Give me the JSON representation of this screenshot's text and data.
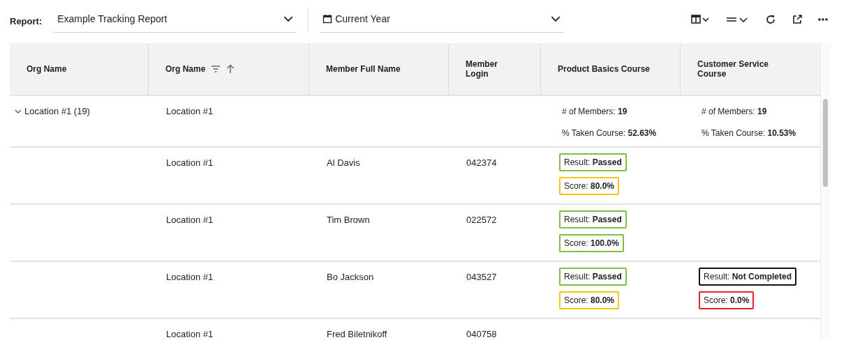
{
  "toolbar": {
    "report_label": "Report:",
    "report_select": "Example Tracking Report",
    "period_select": "Current Year"
  },
  "table": {
    "columns": [
      {
        "label": "Org Name"
      },
      {
        "label": "Org Name",
        "filterable": true,
        "sorted_ascending": true
      },
      {
        "label": "Member Full Name"
      },
      {
        "label": "Member Login"
      },
      {
        "label": "Product Basics Course"
      },
      {
        "label": "Customer Service Course"
      }
    ],
    "rows": [
      {
        "kind": "group",
        "expanded": true,
        "group": "Location #1 (19)",
        "org": "Location #1",
        "courses": {
          "product_basics": {
            "lines": [
              "# of Members: **19**",
              "% Taken Course: **52.63%**"
            ]
          },
          "customer_service": {
            "lines": [
              "# of Members: **19**",
              "% Taken Course: **10.53%**"
            ]
          }
        }
      },
      {
        "kind": "member",
        "org": "Location #1",
        "name": "Al Davis",
        "login": "042374",
        "courses": {
          "product_basics": {
            "tags": [
              {
                "text": "Result: **Passed**",
                "color": "#7ac143"
              },
              {
                "text": "Score: **80.0%**",
                "color": "#f5c518"
              }
            ]
          }
        }
      },
      {
        "kind": "member",
        "org": "Location #1",
        "name": "Tim Brown",
        "login": "022572",
        "courses": {
          "product_basics": {
            "tags": [
              {
                "text": "Result: **Passed**",
                "color": "#7ac143"
              },
              {
                "text": "Score: **100.0%**",
                "color": "#7ac143"
              }
            ]
          }
        }
      },
      {
        "kind": "member",
        "org": "Location #1",
        "name": "Bo Jackson",
        "login": "043527",
        "courses": {
          "product_basics": {
            "tags": [
              {
                "text": "Result: **Passed**",
                "color": "#7ac143"
              },
              {
                "text": "Score: **80.0%**",
                "color": "#f5c518"
              }
            ]
          },
          "customer_service": {
            "tags": [
              {
                "text": "Result: **Not Completed**",
                "color": "#111111"
              },
              {
                "text": "Score: **0.0%**",
                "color": "#e8202a"
              }
            ]
          }
        }
      },
      {
        "kind": "member",
        "org": "Location #1",
        "name": "Fred Biletnikoff",
        "login": "040758"
      }
    ]
  }
}
